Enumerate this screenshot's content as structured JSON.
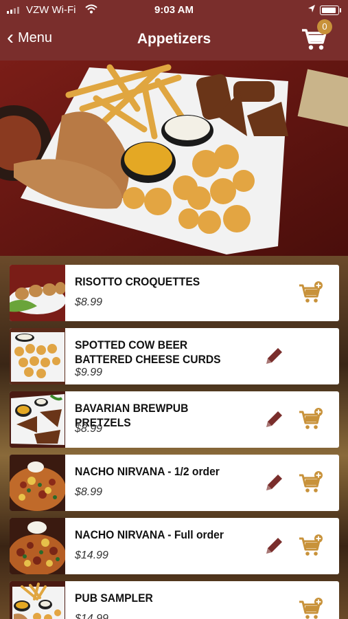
{
  "status": {
    "carrier": "VZW Wi-Fi",
    "time": "9:03 AM"
  },
  "nav": {
    "back_label": "Menu",
    "title": "Appetizers",
    "cart_count": "0"
  },
  "colors": {
    "brand": "#7a2e2c",
    "accent": "#c8923a",
    "edit": "#7a2e2c"
  },
  "items": [
    {
      "name": "RISOTTO CROQUETTES",
      "price": "$8.99",
      "editable": false
    },
    {
      "name": "SPOTTED COW BEER BATTERED CHEESE CURDS",
      "price": "$9.99",
      "editable": true
    },
    {
      "name": "BAVARIAN BREWPUB PRETZELS",
      "price": "$8.99",
      "editable": true
    },
    {
      "name": "NACHO NIRVANA - 1/2 order",
      "price": "$8.99",
      "editable": true
    },
    {
      "name": "NACHO NIRVANA - Full order",
      "price": "$14.99",
      "editable": true
    },
    {
      "name": "PUB SAMPLER",
      "price": "$14.99",
      "editable": false
    }
  ]
}
